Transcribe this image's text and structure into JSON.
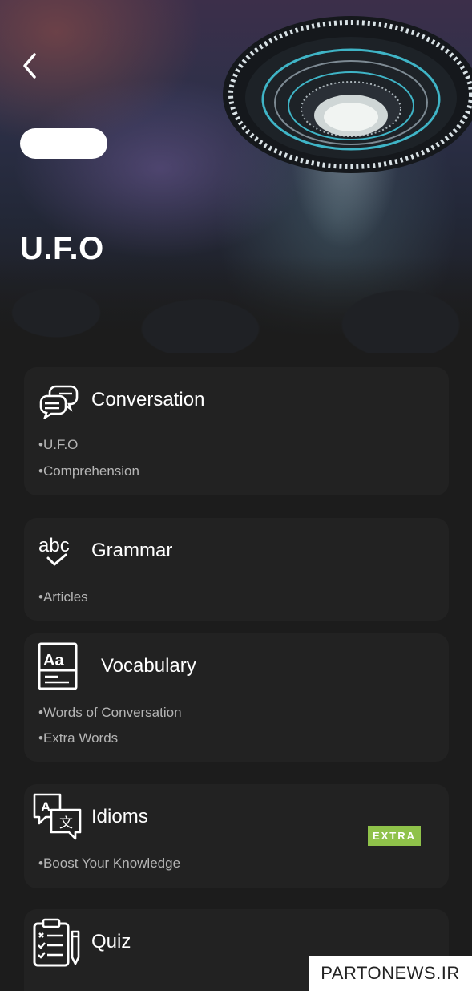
{
  "header": {
    "title": "U.F.O",
    "pill_label": ""
  },
  "cards": [
    {
      "title": "Conversation",
      "icon": "chat-bubbles-icon",
      "items": [
        "•U.F.O",
        "•Comprehension"
      ]
    },
    {
      "title": "Grammar",
      "icon": "abc-check-icon",
      "items": [
        "•Articles"
      ]
    },
    {
      "title": "Vocabulary",
      "icon": "dictionary-icon",
      "items": [
        "•Words of Conversation",
        "•Extra Words"
      ]
    },
    {
      "title": "Idioms",
      "icon": "translate-icon",
      "badge": "EXTRA",
      "items": [
        "•Boost Your Knowledge"
      ]
    },
    {
      "title": "Quiz",
      "icon": "clipboard-checklist-icon",
      "items": []
    }
  ],
  "watermark": "PARTONEWS.IR",
  "colors": {
    "background": "#1c1c1c",
    "card": "#222222",
    "badge": "#8fc24a"
  }
}
